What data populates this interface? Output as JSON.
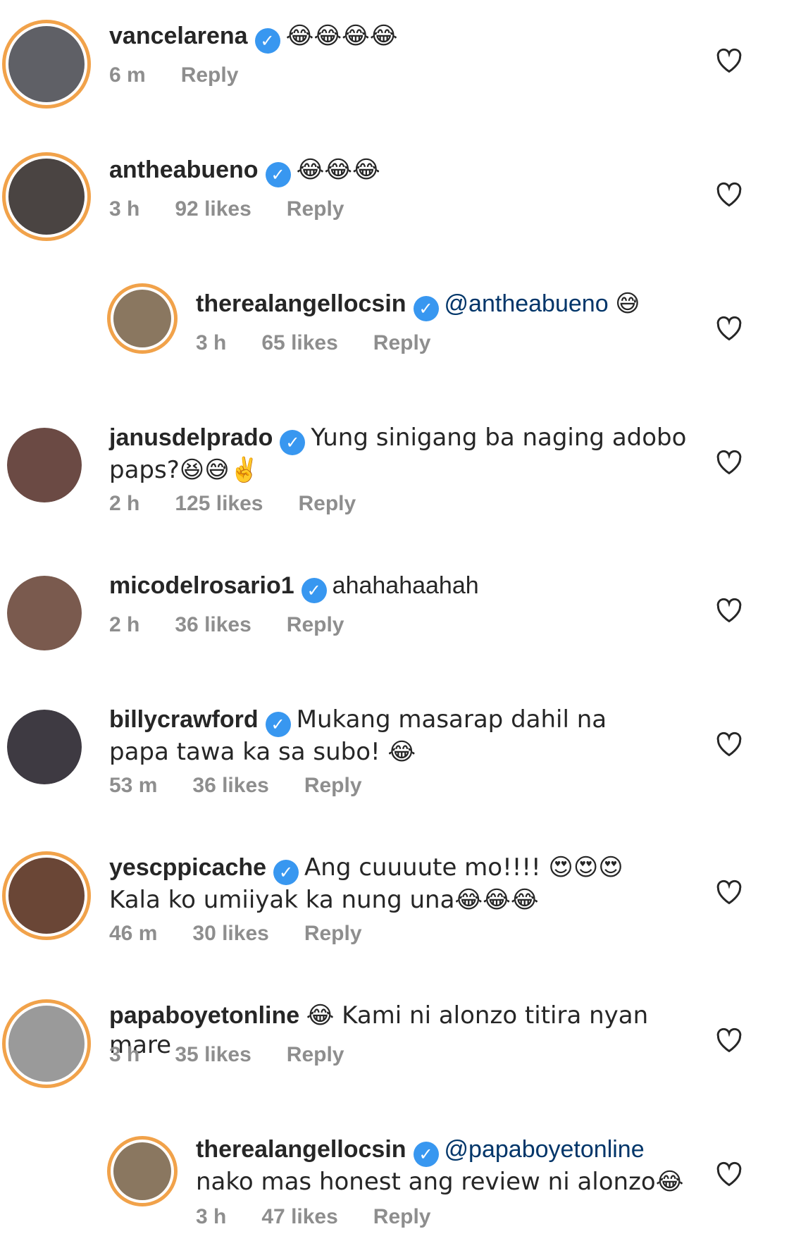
{
  "comments": [
    {
      "username": "vancelarena",
      "text": "😂😂😂😂",
      "time": "6 m",
      "likes": "",
      "reply": "Reply"
    },
    {
      "username": "antheabueno",
      "text": "😂😂😂",
      "time": "3 h",
      "likes": "92 likes",
      "reply": "Reply"
    },
    {
      "username": "therealangellocsin",
      "text": "😅",
      "mention": "@antheabueno",
      "time": "3 h",
      "likes": "65 likes",
      "reply": "Reply"
    },
    {
      "username": "janusdelprado",
      "text": "Yung sinigang ba naging adobo paps?😆😅✌️",
      "time": "2 h",
      "likes": "125 likes",
      "reply": "Reply"
    },
    {
      "username": "micodelrosario1",
      "text": "ahahahaahah",
      "time": "2 h",
      "likes": "36 likes",
      "reply": "Reply"
    },
    {
      "username": "billycrawford",
      "text": "Mukang masarap dahil na papa tawa ka sa subo! 😂",
      "time": "53 m",
      "likes": "36 likes",
      "reply": "Reply"
    },
    {
      "username": "yescppicache",
      "text": "Ang cuuuute mo!!!! 😍😍😍 Kala ko umiiyak ka nung una😂😂😂",
      "time": "46 m",
      "likes": "30 likes",
      "reply": "Reply"
    },
    {
      "username": "papaboyetonline",
      "text": "😂 Kami ni alonzo titira nyan mare",
      "time": "3 h",
      "likes": "35 likes",
      "reply": "Reply"
    },
    {
      "username": "therealangellocsin",
      "text": "nako mas honest ang review ni alonzo😂",
      "mention": "@papaboyetonline",
      "time": "3 h",
      "likes": "47 likes",
      "reply": "Reply"
    }
  ],
  "icons": {
    "verified": "verified-badge-icon",
    "like": "heart-outline-icon"
  },
  "colors": {
    "verified": "#3897f0",
    "story_ring": "#f1a24a",
    "meta": "#8e8e8e",
    "mention": "#003569"
  }
}
